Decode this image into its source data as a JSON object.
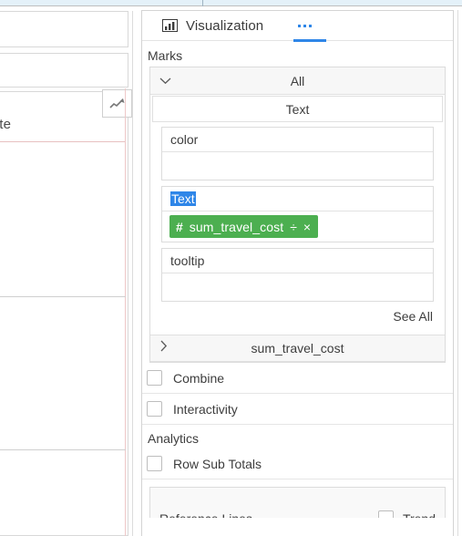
{
  "left_panel": {
    "trend_icon": "trending-up-icon",
    "clipped_label": "site"
  },
  "right_panel": {
    "tabs": {
      "visualization": {
        "label": "Visualization",
        "icon": "bar-chart-icon"
      },
      "more": {
        "label": "···",
        "icon": "ellipsis-icon",
        "active": true
      }
    },
    "accent_color": "#2f86e8",
    "sections": {
      "marks": {
        "label": "Marks",
        "all_row": {
          "label": "All",
          "chevron": "chevron-down-icon"
        },
        "mark_type": "Text",
        "shelves": [
          {
            "name": "color",
            "selected": false,
            "pills": []
          },
          {
            "name": "Text",
            "selected": true,
            "pills": [
              {
                "field": "sum_travel_cost",
                "type_icon": "#",
                "aggregate_icon": "÷",
                "remove_icon": "×",
                "color": "#4caf50"
              }
            ]
          },
          {
            "name": "tooltip",
            "selected": false,
            "pills": []
          }
        ],
        "see_all": "See All",
        "collapsed_field": {
          "label": "sum_travel_cost",
          "chevron": "chevron-right-icon"
        }
      },
      "options": [
        {
          "label": "Combine",
          "checked": false
        },
        {
          "label": "Interactivity",
          "checked": false
        }
      ],
      "analytics": {
        "label": "Analytics",
        "options": [
          {
            "label": "Row Sub Totals",
            "checked": false
          }
        ]
      },
      "bottom_partial": {
        "left_label": "Reference Lines",
        "right_label": "Trend",
        "right_checked": false
      }
    }
  }
}
